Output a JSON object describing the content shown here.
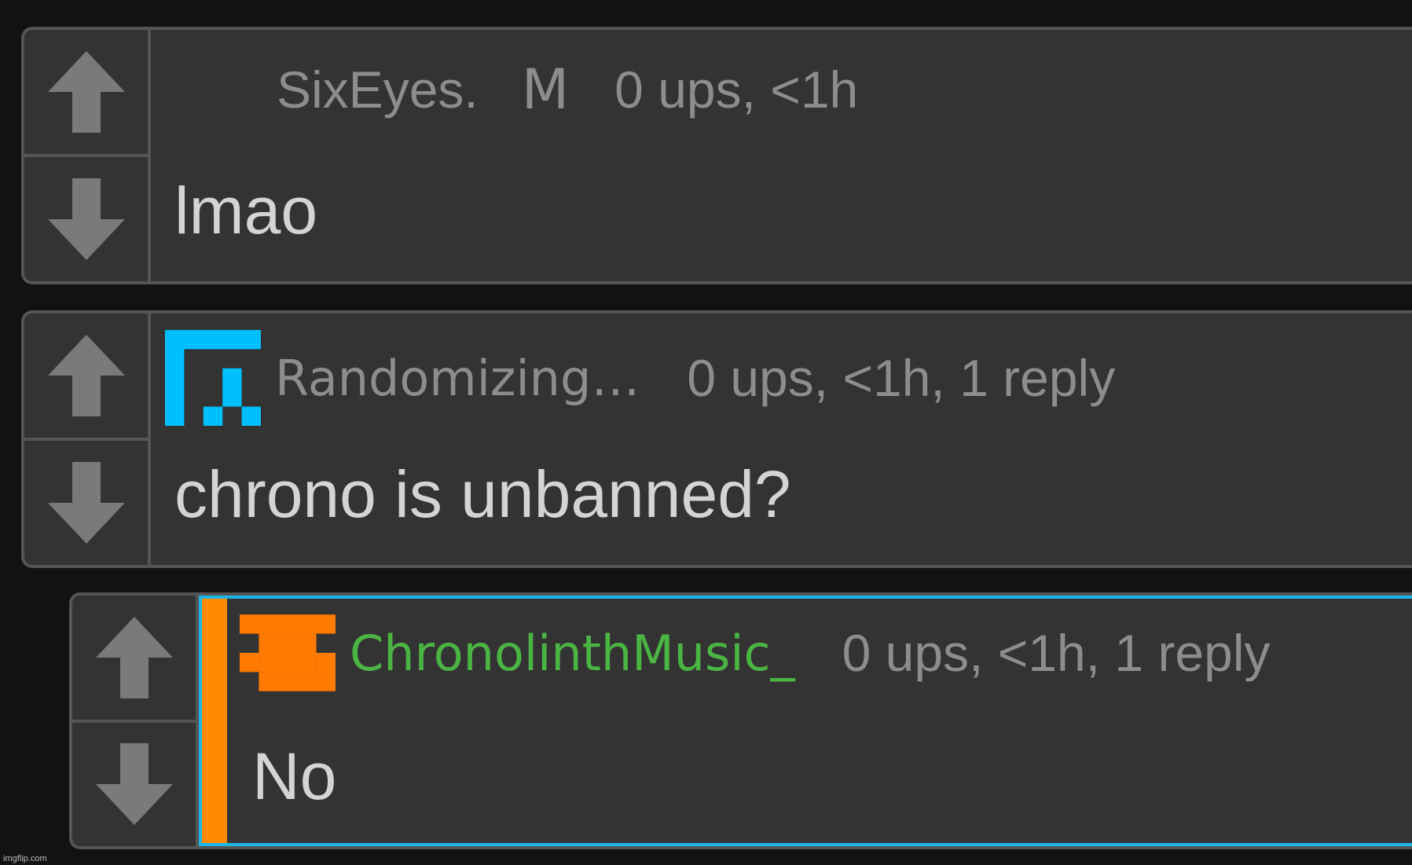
{
  "colors": {
    "page_bg": "#121212",
    "card_bg": "#333333",
    "border": "#555555",
    "arrow": "#7a7a7a",
    "meta_text": "#8d8d8d",
    "body_text": "#d4d4d4",
    "username_green": "#4bb543",
    "highlight_blue": "#1bb7e8",
    "accent_orange": "#ff8a00",
    "avatar_blue": "#00bfff",
    "avatar_orange": "#ff7a00"
  },
  "comments": [
    {
      "username": "SixEyes.",
      "badge": "M",
      "stats": "0 ups, <1h",
      "text": "lmao",
      "avatar": null
    },
    {
      "username": "Randomizing…",
      "stats": "0 ups, <1h, 1 reply",
      "text": "chrono is unbanned?",
      "avatar": "pixel-avatar-blue"
    },
    {
      "username": "ChronolinthMusic_",
      "stats": "0 ups, <1h, 1 reply",
      "text": "No",
      "avatar": "pixel-avatar-orange",
      "highlighted": true
    }
  ],
  "watermark": "imgflip.com"
}
